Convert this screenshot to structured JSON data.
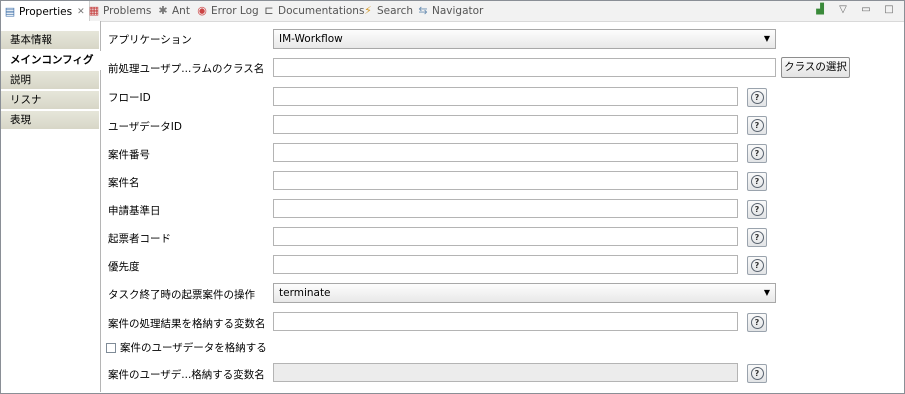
{
  "tabs": [
    {
      "label": "Properties",
      "icon": "properties-icon",
      "active": true
    },
    {
      "label": "Problems",
      "icon": "problems-icon"
    },
    {
      "label": "Ant",
      "icon": "ant-icon"
    },
    {
      "label": "Error Log",
      "icon": "error-log-icon"
    },
    {
      "label": "Documentations",
      "icon": "documentation-icon"
    },
    {
      "label": "Search",
      "icon": "search-icon"
    },
    {
      "label": "Navigator",
      "icon": "navigator-icon"
    }
  ],
  "sidebar": {
    "items": [
      {
        "label": "基本情報"
      },
      {
        "label": "メインコンフィグ",
        "selected": true
      },
      {
        "label": "説明"
      },
      {
        "label": "リスナ"
      },
      {
        "label": "表現"
      }
    ]
  },
  "form": {
    "application": {
      "label": "アプリケーション",
      "value": "IM-Workflow"
    },
    "preprocess_class": {
      "label": "前処理ユーザプ...ラムのクラス名",
      "value": "",
      "button": "クラスの選択"
    },
    "flow_id": {
      "label": "フローID",
      "value": ""
    },
    "user_data_id": {
      "label": "ユーザデータID",
      "value": ""
    },
    "matter_number": {
      "label": "案件番号",
      "value": ""
    },
    "matter_name": {
      "label": "案件名",
      "value": ""
    },
    "apply_base_date": {
      "label": "申請基準日",
      "value": ""
    },
    "applicant_code": {
      "label": "起票者コード",
      "value": ""
    },
    "priority": {
      "label": "優先度",
      "value": ""
    },
    "task_end_op": {
      "label": "タスク終了時の起票案件の操作",
      "value": "terminate"
    },
    "result_var": {
      "label": "案件の処理結果を格納する変数名",
      "value": ""
    },
    "store_user_data": {
      "label": "案件のユーザデータを格納する",
      "checked": false
    },
    "user_data_var": {
      "label": "案件のユーザデ...格納する変数名",
      "value": "",
      "disabled": true
    },
    "help_symbol": "?"
  }
}
